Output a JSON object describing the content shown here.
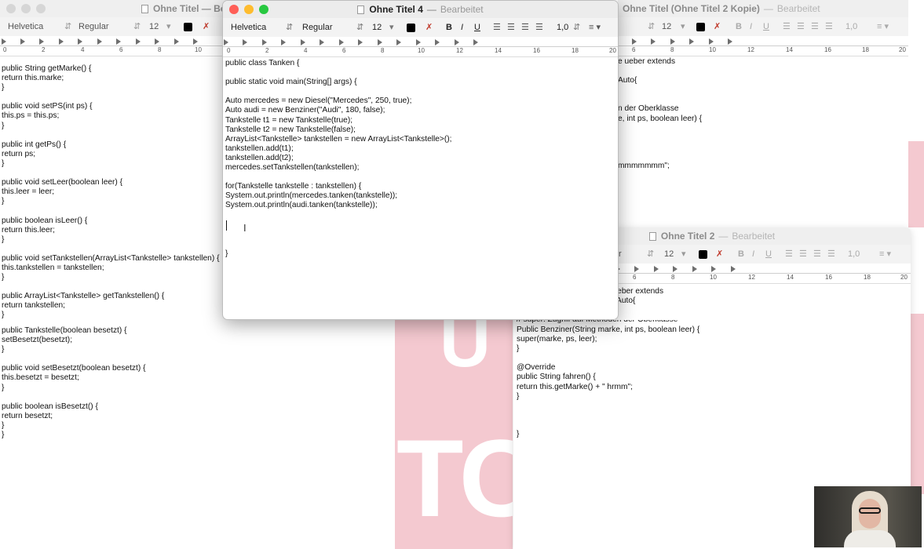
{
  "colors": {
    "traffic_close": "#ff5f57",
    "traffic_min": "#febc2e",
    "traffic_max": "#28c840",
    "inactive_dot": "#d6d6d6",
    "pink_bg": "#f4c9d0"
  },
  "background_letters": [
    "U",
    "TC"
  ],
  "win_left": {
    "title": "Ohne Titel — Be",
    "font": "Helvetica",
    "style": "Regular",
    "size": "12",
    "ruler_numbers": [
      "0",
      "2",
      "4",
      "6",
      "8",
      "10"
    ],
    "lines": [
      "public String getMarke() {",
      "return this.marke;",
      "}",
      "",
      "public void setPS(int ps) {",
      "this.ps = this.ps;",
      "}",
      "",
      "public int getPs() {",
      "return ps;",
      "}",
      "",
      "public void setLeer(boolean leer) {",
      "this.leer = leer;",
      "}",
      "",
      "public boolean isLeer() {",
      "return this.leer;",
      "}",
      "",
      "public void setTankstellen(ArrayList<Tankstelle> tankstellen) {",
      "this.tankstellen = tankstellen;",
      "}",
      "",
      "public ArrayList<Tankstelle> getTankstellen() {",
      "return tankstellen;",
      "}"
    ],
    "lines_below": [
      "public Tankstelle(boolean besetzt) {",
      "setBesetzt(besetzt);",
      "}",
      "",
      "public void setBesetzt(boolean besetzt) {",
      "this.besetzt = besetzt;",
      "}",
      "",
      "public boolean isBesetzt() {",
      "return besetzt;",
      "}",
      "}"
    ]
  },
  "win4": {
    "title": "Ohne Titel 4",
    "status": "Bearbeitet",
    "font": "Helvetica",
    "style": "Regular",
    "size": "12",
    "bold": "B",
    "italic": "I",
    "underline": "U",
    "spacing": "1,0",
    "ruler_numbers": [
      "0",
      "2",
      "4",
      "6",
      "8",
      "10",
      "12",
      "14",
      "16",
      "18",
      "20"
    ],
    "lines": [
      "public class Tanken {",
      "",
      "public static void main(String[] args) {",
      "",
      "Auto mercedes = new Diesel(\"Mercedes\", 250, true);",
      "Auto audi = new Benziner(\"Audi\", 180, false);",
      "Tankstelle t1 = new Tankstelle(true);",
      "Tankstelle t2 = new Tankstelle(false);",
      "ArrayList<Tankstelle> tankstellen = new ArrayList<Tankstelle>();",
      "tankstellen.add(t1);",
      "tankstellen.add(t2);",
      "mercedes.setTankstellen(tankstellen);",
      "",
      "for(Tankstelle tankstelle : tankstellen) {",
      "System.out.println(mercedes.tanken(tankstelle));",
      "System.out.println(audi.tanken(tankstelle));"
    ],
    "closing_brace": "}",
    "cursor_glyph": "I"
  },
  "win_kopie": {
    "title": "Ohne Titel (Ohne Titel 2 Kopie)",
    "status": "Bearbeitet",
    "size": "12",
    "spacing": "1,0",
    "ruler_numbers": [
      "6",
      "8",
      "10",
      "12",
      "14",
      "16",
      "18",
      "20"
    ],
    "lines": [
      "e ueber extends",
      "",
      "Auto{",
      "",
      "",
      "n der Oberklasse",
      "e, int ps, boolean leer) {",
      "",
      "",
      "",
      "",
      "mmmmmmm\";"
    ]
  },
  "win2": {
    "title": "Ohne Titel 2",
    "status": "Bearbeitet",
    "style_partial": "r",
    "size": "12",
    "spacing": "1,0",
    "ruler_numbers": [
      "6",
      "8",
      "10",
      "12",
      "14",
      "16",
      "18",
      "20"
    ],
    "lines_top": [
      "e ueber extends",
      "ds Auto{"
    ],
    "comment_partial": "// super: Zugriff auf Methoden der Oberklasse",
    "lines": [
      "Public Benziner(String marke, int ps, boolean leer) {",
      "super(marke, ps, leer);",
      "}",
      "",
      "@Override",
      "public String fahren() {",
      "return this.getMarke() + \" hrmm\";",
      "}",
      "",
      "",
      "",
      "}"
    ]
  },
  "webcam": {
    "label": "presenter webcam"
  }
}
